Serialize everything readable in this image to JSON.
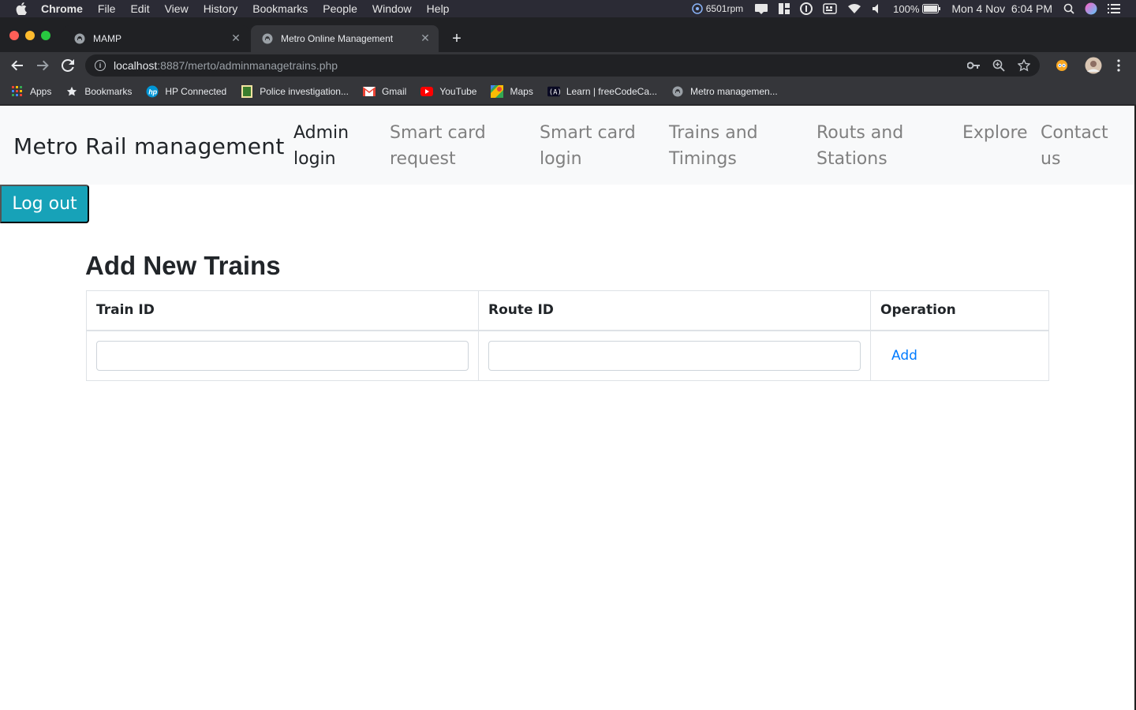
{
  "menubar": {
    "app_name": "Chrome",
    "items": [
      "File",
      "Edit",
      "View",
      "History",
      "Bookmarks",
      "People",
      "Window",
      "Help"
    ],
    "fan_speed": "6501rpm",
    "battery": "100%",
    "datetime": "Mon 4 Nov  6:04 PM"
  },
  "tabs": [
    {
      "title": "MAMP",
      "icon": "elephant-icon"
    },
    {
      "title": "Metro Online Management",
      "icon": "elephant-icon"
    }
  ],
  "address": {
    "host": "localhost",
    "path": ":8887/merto/adminmanagetrains.php"
  },
  "bookmarks": [
    {
      "label": "Apps",
      "icon": "apps-grid-icon"
    },
    {
      "label": "Bookmarks",
      "icon": "star-icon"
    },
    {
      "label": "HP Connected",
      "icon": "hp-icon"
    },
    {
      "label": "Police investigation...",
      "icon": "police-icon"
    },
    {
      "label": "Gmail",
      "icon": "gmail-icon"
    },
    {
      "label": "YouTube",
      "icon": "youtube-icon"
    },
    {
      "label": "Maps",
      "icon": "maps-icon"
    },
    {
      "label": "Learn | freeCodeCa...",
      "icon": "freecodecamp-icon"
    },
    {
      "label": "Metro managemen...",
      "icon": "elephant-icon"
    }
  ],
  "navbar": {
    "brand": "Metro Rail management",
    "links": [
      {
        "line1": "Admin",
        "line2": "login"
      },
      {
        "line1": "Smart card",
        "line2": "request"
      },
      {
        "line1": "Smart card",
        "line2": "login"
      },
      {
        "line1": "Trains and",
        "line2": "Timings"
      },
      {
        "line1": "Routs and",
        "line2": "Stations"
      },
      {
        "line1": "Explore",
        "line2": ""
      },
      {
        "line1": "Contact",
        "line2": "us"
      }
    ]
  },
  "logout_label": "Log out",
  "form": {
    "heading": "Add New Trains",
    "columns": [
      "Train ID",
      "Route ID",
      "Operation"
    ],
    "train_id_value": "",
    "route_id_value": "",
    "add_label": "Add"
  },
  "colors": {
    "logout_bg": "#17a2b8",
    "link_blue": "#007bff",
    "navbar_bg": "#f8f9fa"
  }
}
